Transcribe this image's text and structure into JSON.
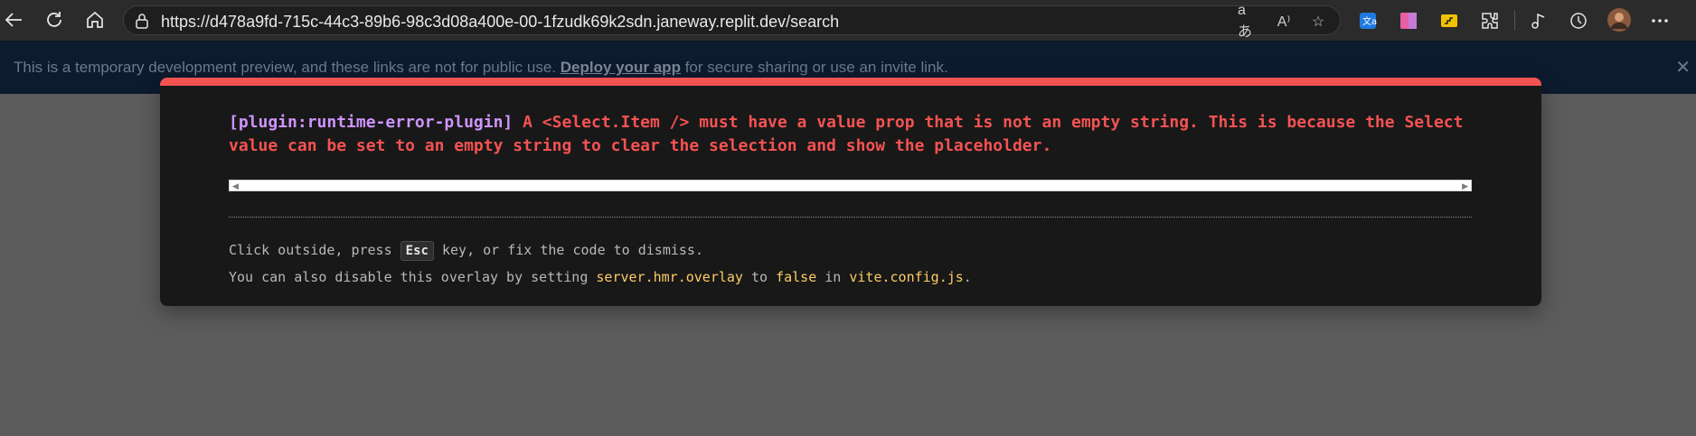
{
  "browser": {
    "url": "https://d478a9fd-715c-44c3-89b6-98c3d08a400e-00-1fzudk69k2sdn.janeway.replit.dev/search",
    "nav_icons": [
      "back-icon",
      "refresh-icon",
      "home-icon"
    ],
    "address_actions": [
      "translate-icon",
      "read-aloud-icon",
      "favorite-star-icon"
    ],
    "extension_icons": [
      "translator-extension-icon",
      "pink-extension-icon",
      "yellow-extension-icon",
      "extensions-puzzle-icon"
    ],
    "right_icons": [
      "media-icon",
      "history-icon",
      "profile-avatar",
      "more-menu-icon"
    ]
  },
  "banner": {
    "text_before": "This is a temporary development preview, and these links are not for public use.",
    "link": "Deploy your app",
    "text_after": "for secure sharing or use an invite link.",
    "close": "✕"
  },
  "overlay": {
    "plugin": "[plugin:runtime-error-plugin]",
    "message": "A <Select.Item /> must have a value prop that is not an empty string. This is because the Select value can be set to an empty string to clear the selection and show the placeholder.",
    "tip1_before": "Click outside, press",
    "tip1_key": "Esc",
    "tip1_after": "key, or fix the code to dismiss.",
    "tip2_before": "You can also disable this overlay by setting",
    "tip2_code1": "server.hmr.overlay",
    "tip2_mid": "to",
    "tip2_code2": "false",
    "tip2_in": "in",
    "tip2_code3": "vite.config.js",
    "tip2_end": "."
  },
  "colors": {
    "error_red": "#f55252",
    "plugin_purple": "#cf94ff",
    "code_yellow": "#ffcc66",
    "banner_bg": "#0d1b2e"
  }
}
